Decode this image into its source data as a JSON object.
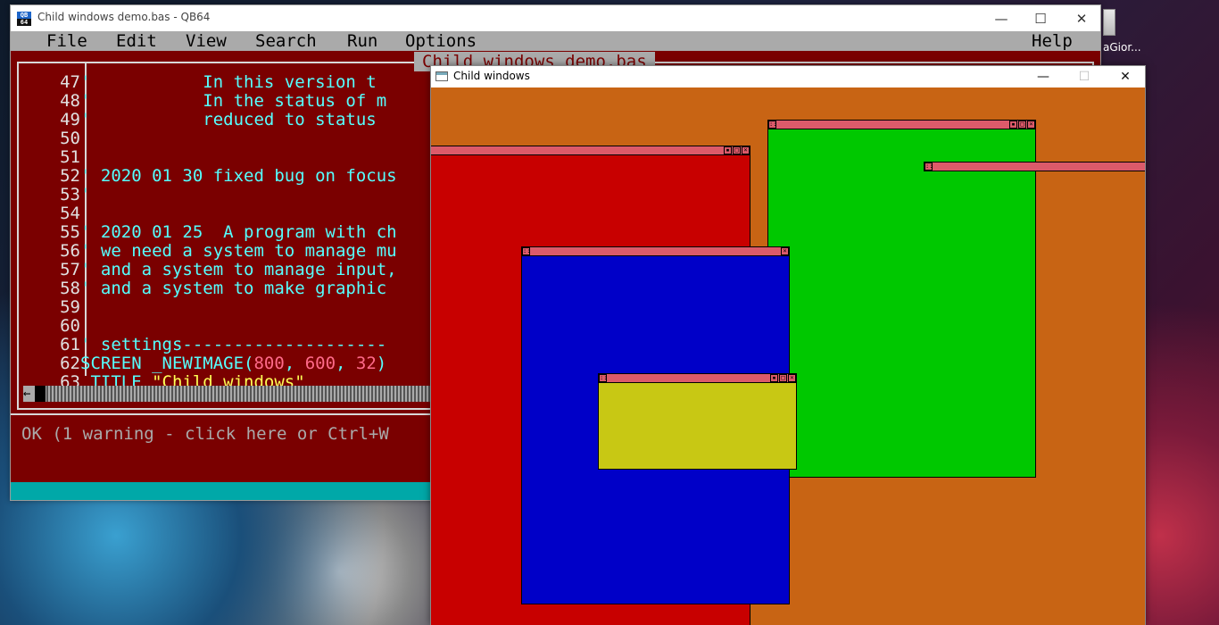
{
  "desktop": {
    "icon_label": "aGior..."
  },
  "qb64": {
    "title": "Child windows demo.bas - QB64",
    "app_icon_top": "QB",
    "app_icon_bottom": "64",
    "menu": [
      "File",
      "Edit",
      "View",
      "Search",
      "Run",
      "Options",
      "Help"
    ],
    "file_title": "Child windows demo.bas",
    "code": [
      {
        "ln": "47",
        "text": "'           In this version t"
      },
      {
        "ln": "48",
        "text": "'           In the status of m"
      },
      {
        "ln": "49",
        "text": "'           reduced to status"
      },
      {
        "ln": "50",
        "text": ""
      },
      {
        "ln": "51",
        "text": ""
      },
      {
        "ln": "52",
        "text": "' 2020 01 30 fixed bug on focus"
      },
      {
        "ln": "53",
        "text": "'"
      },
      {
        "ln": "54",
        "text": ""
      },
      {
        "ln": "55",
        "text": "' 2020 01 25  A program with ch"
      },
      {
        "ln": "56",
        "text": "' we need a system to manage mu"
      },
      {
        "ln": "57",
        "text": "' and a system to manage input,"
      },
      {
        "ln": "58",
        "text": "' and a system to make graphic"
      },
      {
        "ln": "59",
        "text": ""
      },
      {
        "ln": "60",
        "text": ""
      },
      {
        "ln": "61",
        "text": "' settings--------------------"
      }
    ],
    "line62": {
      "ln": "62",
      "kw": "SCREEN _NEWIMAGE(",
      "n1": "800",
      "c1": ", ",
      "n2": "600",
      "c2": ", ",
      "n3": "32",
      "end": ")"
    },
    "line63": {
      "ln": "63",
      "kw": "_TITLE ",
      "str": "\"Child windows\""
    },
    "hscroll_left_glyph": "←",
    "status": "OK (1 warning - click here or Ctrl+W"
  },
  "child_app": {
    "title": "Child windows",
    "colors": {
      "background": "#c86414",
      "red": "#c80000",
      "green": "#00c800",
      "blue": "#0000c8",
      "yellow": "#c8c814",
      "titlebar": "#dc5a6a"
    }
  }
}
